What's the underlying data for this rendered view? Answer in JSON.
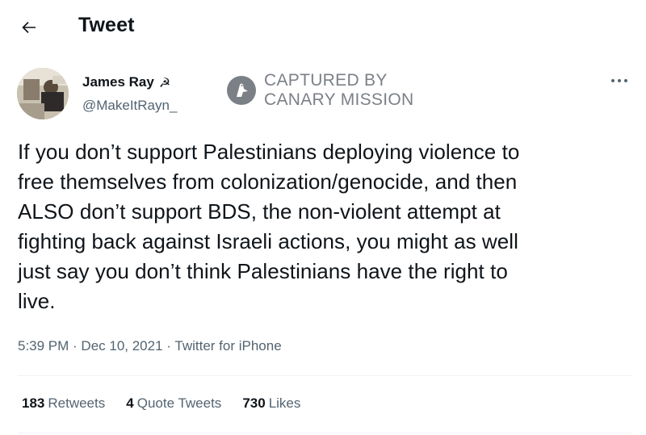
{
  "header": {
    "back_icon": "arrow-left-icon",
    "title": "Tweet"
  },
  "author": {
    "display_name": "James Ray",
    "name_emoji": "☭",
    "handle": "@MakeItRayn_"
  },
  "watermark": {
    "line1": "CAPTURED BY",
    "line2": "CANARY MISSION"
  },
  "more_icon": "more-horizontal-icon",
  "tweet": {
    "text": "If you don’t support Palestinians deploying violence to\nfree themselves from colonization/genocide, and then\nALSO don’t support BDS, the non-violent attempt at\nfighting back against Israeli actions, you might as well\njust say you don’t think Palestinians have the right to\nlive."
  },
  "meta": {
    "time": "5:39 PM",
    "separator1": " · ",
    "date": "Dec 10, 2021",
    "separator2": " · ",
    "source": "Twitter for iPhone"
  },
  "stats": {
    "retweets_count": "183",
    "retweets_label": "Retweets",
    "quotes_count": "4",
    "quotes_label": "Quote Tweets",
    "likes_count": "730",
    "likes_label": "Likes"
  },
  "colors": {
    "text_primary": "#0f1419",
    "text_secondary": "#536471",
    "divider": "#eff3f4",
    "watermark": "#7b8087"
  }
}
